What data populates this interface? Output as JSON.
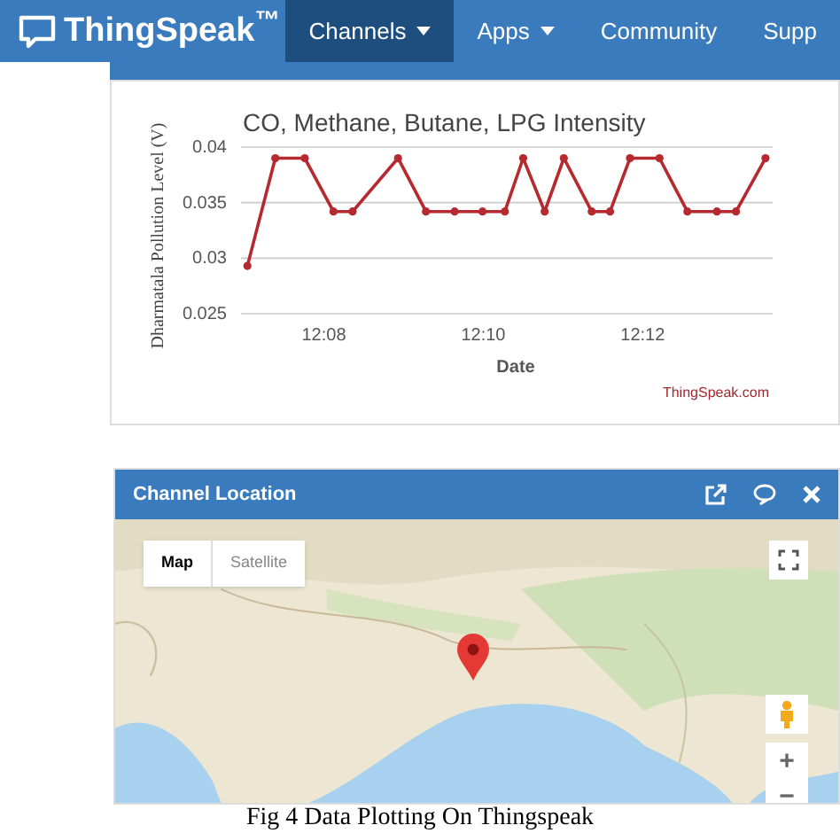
{
  "navbar": {
    "logo": "ThingSpeak$^{™}$",
    "items": [
      {
        "label": "Channels",
        "dropdown": true,
        "selected": true
      },
      {
        "label": "Apps",
        "dropdown": true,
        "selected": false
      },
      {
        "label": "Community",
        "dropdown": false,
        "selected": false
      },
      {
        "label": "Supp",
        "dropdown": false,
        "selected": false
      }
    ]
  },
  "chart_card": {
    "chart_data": {
      "type": "line",
      "title": "CO, Methane, Butane, LPG Intensity",
      "xlabel": "Date",
      "ylabel": "Dharmatala Pollution Level (V)",
      "x": [
        727.04,
        727.39,
        727.76,
        728.12,
        728.36,
        728.93,
        729.28,
        729.64,
        729.99,
        730.27,
        730.5,
        730.77,
        731.01,
        731.36,
        731.59,
        731.84,
        732.21,
        732.56,
        732.93,
        733.17,
        733.54
      ],
      "series": [
        {
          "marker": "circle",
          "color": "#b5292f",
          "values": [
            0.0293,
            0.039,
            0.039,
            0.0342,
            0.0342,
            0.039,
            0.0342,
            0.0342,
            0.0342,
            0.0342,
            0.039,
            0.0342,
            0.039,
            0.0342,
            0.0342,
            0.039,
            0.039,
            0.0342,
            0.0342,
            0.0342,
            0.039
          ]
        }
      ],
      "xlim": [
        726.96,
        733.63
      ],
      "ylim": [
        0.025,
        0.04
      ],
      "xticks": [
        {
          "value": 728,
          "label": "12:08"
        },
        {
          "value": 730,
          "label": "12:10"
        },
        {
          "value": 732,
          "label": "12:12"
        }
      ],
      "yticks": [
        {
          "value": 0.025,
          "label": "0.025"
        },
        {
          "value": 0.03,
          "label": "0.03"
        },
        {
          "value": 0.035,
          "label": "0.035"
        },
        {
          "value": 0.04,
          "label": "0.04"
        }
      ]
    },
    "credit": "ThingSpeak.com"
  },
  "location_panel": {
    "title": "Channel Location",
    "map": {
      "kind": "picture",
      "map_types": [
        {
          "label": "Map",
          "selected": true
        },
        {
          "label": "Satellite",
          "selected": false
        }
      ],
      "zoom_in": "+",
      "zoom_out": "−"
    }
  },
  "caption": "Fig 4 Data Plotting On Thingspeak"
}
